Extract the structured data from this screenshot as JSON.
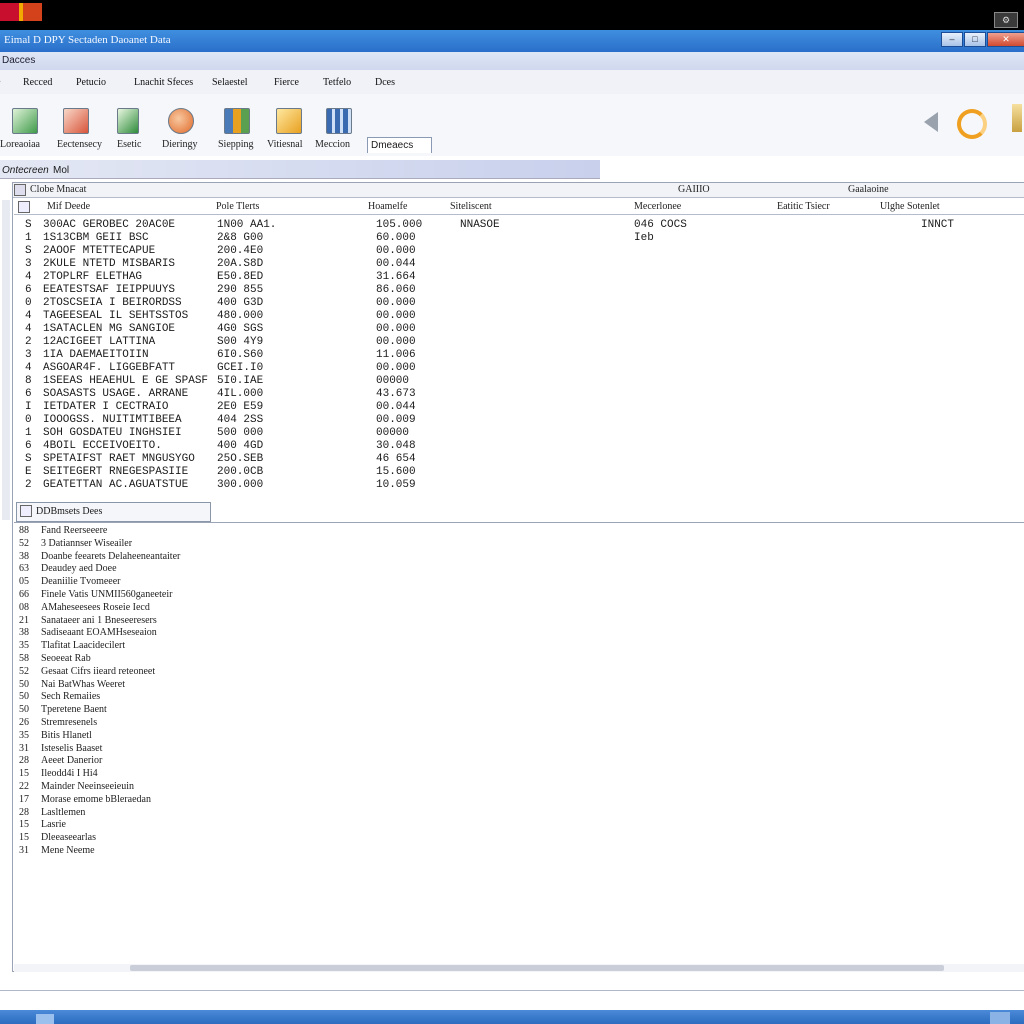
{
  "window": {
    "title": "Eimal D DPY Sectaden Daoanet Data",
    "subbar_label": "Dacces",
    "controls": {
      "minimize": "–",
      "maximize": "□",
      "close": "✕"
    },
    "corner_icon": "⚙"
  },
  "menu": [
    "Recced",
    "Petucio",
    "Lnachit Sfeces",
    "Selaestel",
    "Fierce",
    "Tetfelo",
    "Dces"
  ],
  "toolbar": {
    "buttons": [
      {
        "label": "Loreaoiaa",
        "icon": "chart-icon",
        "color": "#3f9b4a"
      },
      {
        "label": "Eectensecy",
        "icon": "document-icon",
        "color": "#d8543a"
      },
      {
        "label": "Esetic",
        "icon": "spreadsheet-icon",
        "color": "#2e8c3a"
      },
      {
        "label": "Dieringy",
        "icon": "tool-icon",
        "color": "#e06a2a"
      },
      {
        "label": "Siepping",
        "icon": "tiles-icon",
        "color": "#4a7ab8"
      },
      {
        "label": "Vitiesnal",
        "icon": "folder-icon",
        "color": "#e8a020"
      },
      {
        "label": "Meccion",
        "icon": "grid-icon",
        "color": "#3a6ab0"
      }
    ],
    "active_tab": "Dmeaecs",
    "speaker_icon": "speaker-icon",
    "refresh_icon": "refresh-icon",
    "extra_icon": "pencil-icon",
    "accent_orange": "#f0a020"
  },
  "status": {
    "left": "Ontecreen",
    "right": "Mol"
  },
  "grid": {
    "header": {
      "left": "Clobe Mnacat",
      "center": "GAIIIO",
      "right": "Gaalaoine"
    },
    "columns": [
      "Mif Deede",
      "Pole Tlerts",
      "Hoamelfe",
      "Siteliscent",
      "Mecerlonee",
      "Eatitic Tsiecr",
      "Ulghe Sotenlet"
    ],
    "rows": [
      {
        "n": "S",
        "name": "300AC GEROBEC 20AC0E",
        "val": "1N00 AA1.",
        "num": "105.000",
        "col4": "NNASOE",
        "col5": "046 COCS",
        "col7": "INNCT"
      },
      {
        "n": "1",
        "name": "1S13CBM GEII BSC",
        "val": "2&8 G00",
        "num": "60.000",
        "col4": "",
        "col5": "Ieb",
        "col7": ""
      },
      {
        "n": "S",
        "name": "2AOOF MTETTECAPUE",
        "val": "200.4E0",
        "num": "00.000",
        "col4": "",
        "col5": "",
        "col7": ""
      },
      {
        "n": "3",
        "name": "2KULE NTETD MISBARIS",
        "val": "20A.S8D",
        "num": "00.044",
        "col4": "",
        "col5": "",
        "col7": ""
      },
      {
        "n": "4",
        "name": "2TOPLRF ELETHAG",
        "val": "E50.8ED",
        "num": "31.664",
        "col4": "",
        "col5": "",
        "col7": ""
      },
      {
        "n": "6",
        "name": "EEATESTSAF IEIPPUUYS",
        "val": "290 855",
        "num": "86.060",
        "col4": "",
        "col5": "",
        "col7": ""
      },
      {
        "n": "0",
        "name": "2TOSCSEIA I BEIRORDSS",
        "val": "400 G3D",
        "num": "00.000",
        "col4": "",
        "col5": "",
        "col7": ""
      },
      {
        "n": "4",
        "name": "TAGEESEAL IL SEHTSSTOS",
        "val": "480.000",
        "num": "00.000",
        "col4": "",
        "col5": "",
        "col7": ""
      },
      {
        "n": "4",
        "name": "1SATACLEN MG SANGIOE",
        "val": "4G0 SGS",
        "num": "00.000",
        "col4": "",
        "col5": "",
        "col7": ""
      },
      {
        "n": "2",
        "name": "12ACIGEET LATTINA",
        "val": "S00 4Y9",
        "num": "00.000",
        "col4": "",
        "col5": "",
        "col7": ""
      },
      {
        "n": "3",
        "name": "1IA DAEMAEITOIIN",
        "val": "6I0.S60",
        "num": "11.006",
        "col4": "",
        "col5": "",
        "col7": ""
      },
      {
        "n": "4",
        "name": "ASGOAR4F. LIGGEBFATT",
        "val": "GCEI.I0",
        "num": "00.000",
        "col4": "",
        "col5": "",
        "col7": ""
      },
      {
        "n": "8",
        "name": "1SEEAS HEAEHUL E GE SPASF",
        "val": "5I0.IAE",
        "num": "00000",
        "col4": "",
        "col5": "",
        "col7": ""
      },
      {
        "n": "6",
        "name": "SOASASTS USAGE. ARRANE",
        "val": "4IL.000",
        "num": "43.673",
        "col4": "",
        "col5": "",
        "col7": ""
      },
      {
        "n": "I",
        "name": "IETDATER I CECTRAIO",
        "val": "2E0 E59",
        "num": "00.044",
        "col4": "",
        "col5": "",
        "col7": ""
      },
      {
        "n": "0",
        "name": "IOOOGSS. NUITIMTIBEEA",
        "val": "404 2SS",
        "num": "00.009",
        "col4": "",
        "col5": "",
        "col7": ""
      },
      {
        "n": "1",
        "name": "SOH GOSDATEU INGHSIEI",
        "val": "500 000",
        "num": "00000",
        "col4": "",
        "col5": "",
        "col7": ""
      },
      {
        "n": "6",
        "name": "4BOIL ECCEIVOEITO.",
        "val": "400 4GD",
        "num": "30.048",
        "col4": "",
        "col5": "",
        "col7": ""
      },
      {
        "n": "S",
        "name": "SPETAIFST RAET MNGUSYGO",
        "val": "25O.SEB",
        "num": "46 654",
        "col4": "",
        "col5": "",
        "col7": ""
      },
      {
        "n": "E",
        "name": "SEITEGERT RNEGESPASIIE",
        "val": "200.0CB",
        "num": "15.600",
        "col4": "",
        "col5": "",
        "col7": ""
      },
      {
        "n": "2",
        "name": "GEATETTAN AC.AGUATSTUE",
        "val": "300.000",
        "num": "10.059",
        "col4": "",
        "col5": "",
        "col7": ""
      }
    ]
  },
  "details": {
    "title": "DDBmsets Dees",
    "items": [
      {
        "n": "88",
        "text": "Fand Reerseeere"
      },
      {
        "n": "52",
        "text": "3 Datiannser Wiseailer"
      },
      {
        "n": "38",
        "text": "Doanbe feearets Delaheeneantaiter"
      },
      {
        "n": "63",
        "text": "Deaudey aed Doee"
      },
      {
        "n": "05",
        "text": "Deaniilie Tvomeeer"
      },
      {
        "n": "66",
        "text": "Finele Vatis UNMII560ganeeteir"
      },
      {
        "n": "08",
        "text": "AMaheseesees Roseie Iecd"
      },
      {
        "n": "21",
        "text": "Sanataeer ani 1 Bneseeresers"
      },
      {
        "n": "38",
        "text": "Sadiseaant EOAMHseseaion"
      },
      {
        "n": "35",
        "text": "Tlafitat Laacidecilert"
      },
      {
        "n": "58",
        "text": "Seoeeat Rab"
      },
      {
        "n": "52",
        "text": "Gesaat Cifrs iieard reteoneet"
      },
      {
        "n": "50",
        "text": "Nai BatWhas Weeret"
      },
      {
        "n": "50",
        "text": "Sech Remaiies"
      },
      {
        "n": "50",
        "text": "Tperetene Baent"
      },
      {
        "n": "26",
        "text": "Stremresenels"
      },
      {
        "n": "35",
        "text": "Bitis Hlanetl"
      },
      {
        "n": "31",
        "text": "Isteselis Baaset"
      },
      {
        "n": "28",
        "text": "Aeeet Danerior"
      },
      {
        "n": "15",
        "text": "Ileodd4i I Hi4"
      },
      {
        "n": "22",
        "text": "Mainder Neeinseeieuin"
      },
      {
        "n": "17",
        "text": "Morase emome bBleraedan"
      },
      {
        "n": "28",
        "text": "Lasltlemen"
      },
      {
        "n": "15",
        "text": "Lasrie"
      },
      {
        "n": "15",
        "text": "Dleeaseearlas"
      },
      {
        "n": "31",
        "text": "Mene Neeme"
      }
    ]
  }
}
